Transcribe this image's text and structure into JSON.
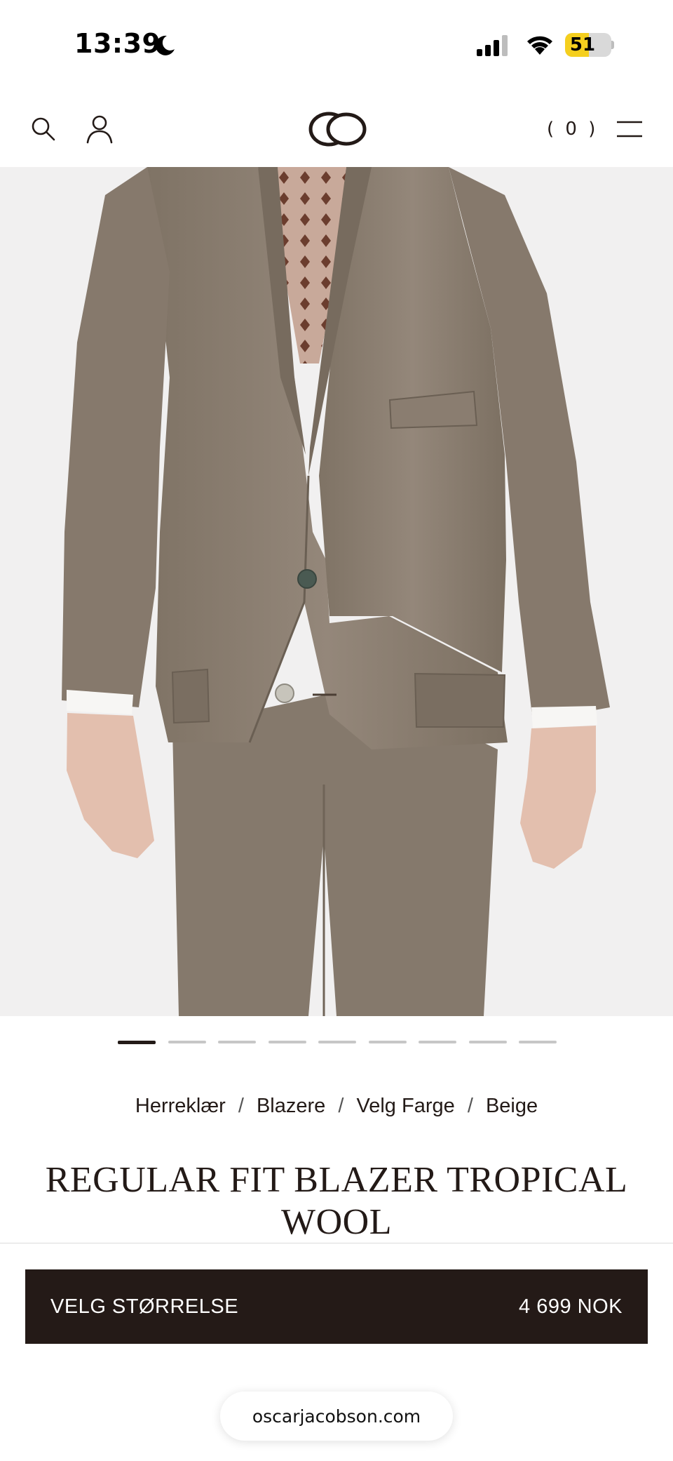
{
  "status_bar": {
    "time": "13:39",
    "battery": "51",
    "battery_level": 0.51,
    "icons": [
      "moon-icon",
      "signal-icon",
      "wifi-icon",
      "battery-icon"
    ]
  },
  "header": {
    "cart_count": "( 0 )",
    "icons": [
      "search-icon",
      "account-icon",
      "brand-logo",
      "menu-icon"
    ]
  },
  "gallery": {
    "image_description": "model-wearing-beige-blazer",
    "slide_count": 9,
    "active_slide": 1
  },
  "breadcrumb": {
    "items": [
      "Herreklær",
      "Blazere",
      "Velg Farge",
      "Beige"
    ],
    "separator": "/"
  },
  "product": {
    "title_line1": "REGULAR FIT BLAZER TROPICAL",
    "title_line2": "WOOL"
  },
  "purchase": {
    "size_label": "VELG STØRRELSE",
    "price": "4 699 NOK"
  },
  "browser": {
    "url": "oscarjacobson.com"
  },
  "colors": {
    "brand_dark": "#241a17",
    "image_background": "#f1f0f0",
    "suit": "#8b7e6f",
    "battery": "#f5cf1e"
  }
}
